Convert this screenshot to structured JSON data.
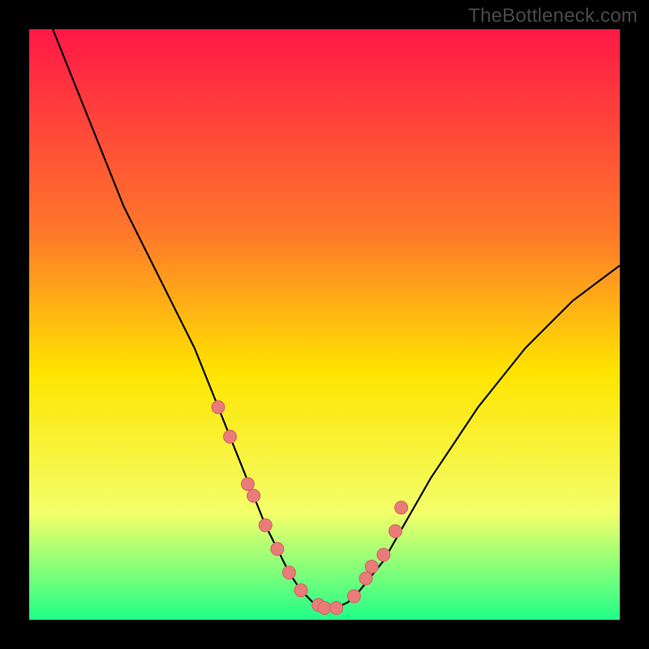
{
  "watermark": "TheBottleneck.com",
  "colors": {
    "background": "#000000",
    "gradient_top": "#ff1846",
    "gradient_mid1": "#ff7a2a",
    "gradient_mid2": "#ffe400",
    "gradient_mid3": "#f3ff6a",
    "gradient_bottom": "#20ff88",
    "curve": "#000000",
    "marker_fill": "#e97b79",
    "marker_stroke": "#d2605e"
  },
  "chart_data": {
    "type": "line",
    "title": "",
    "xlabel": "",
    "ylabel": "",
    "xlim": [
      0,
      100
    ],
    "ylim": [
      0,
      100
    ],
    "series": [
      {
        "name": "bottleneck-curve",
        "x": [
          4,
          8,
          12,
          16,
          20,
          24,
          28,
          30,
          32,
          34,
          36,
          38,
          40,
          42,
          44,
          46,
          48,
          50,
          52,
          54,
          56,
          60,
          64,
          68,
          72,
          76,
          80,
          84,
          88,
          92,
          96,
          100
        ],
        "values": [
          100,
          90,
          80,
          70,
          62,
          54,
          46,
          41,
          36,
          31,
          26,
          21,
          16,
          12,
          8,
          5,
          3,
          2,
          2,
          3,
          5,
          10,
          17,
          24,
          30,
          36,
          41,
          46,
          50,
          54,
          57,
          60
        ]
      }
    ],
    "markers": {
      "name": "highlighted-points",
      "x": [
        32,
        34,
        37,
        38,
        40,
        42,
        44,
        46,
        49,
        50,
        52,
        55,
        57,
        58,
        60,
        62,
        63
      ],
      "values": [
        36,
        31,
        23,
        21,
        16,
        12,
        8,
        5,
        2.5,
        2,
        2,
        4,
        7,
        9,
        11,
        15,
        19
      ]
    }
  }
}
